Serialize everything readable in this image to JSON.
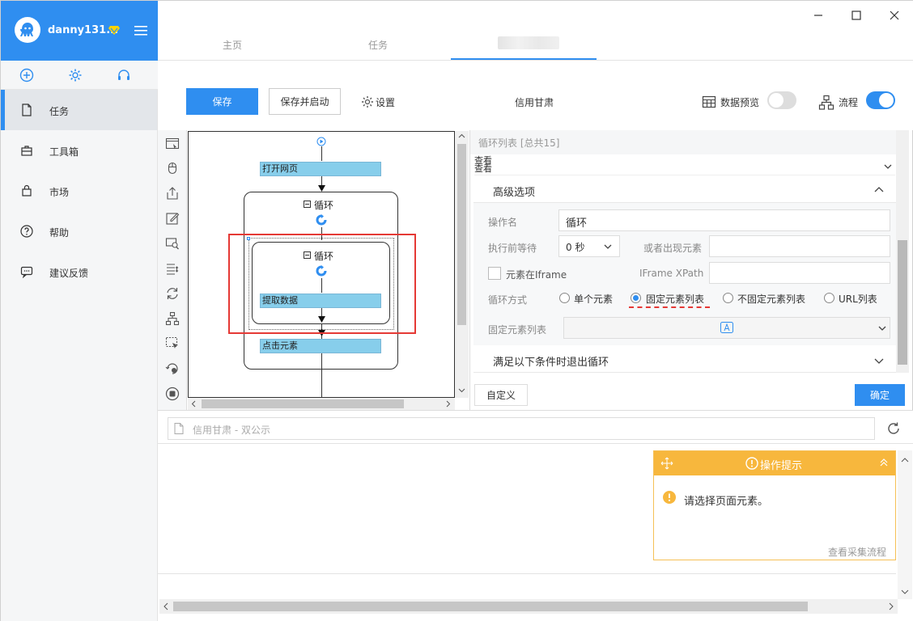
{
  "sidebar": {
    "username": "danny131...",
    "items": [
      {
        "label": "任务"
      },
      {
        "label": "工具箱"
      },
      {
        "label": "市场"
      },
      {
        "label": "帮助"
      },
      {
        "label": "建议反馈"
      }
    ]
  },
  "tabs": [
    {
      "label": "主页"
    },
    {
      "label": "任务"
    }
  ],
  "toolbar": {
    "save": "保存",
    "save_start": "保存并启动",
    "settings": "设置",
    "task_name": "信用甘肃",
    "preview": "数据预览",
    "flow": "流程",
    "preview_on": false,
    "flow_on": true
  },
  "canvas": {
    "open_page": "打开网页",
    "loop1": "循环",
    "loop2": "循环",
    "extract": "提取数据",
    "click": "点击元素"
  },
  "panel": {
    "header": "循环列表 [总共15]",
    "list_line1": "查看",
    "list_line2": "查看",
    "advanced": "高级选项",
    "op_name_label": "操作名",
    "op_name_value": "循环",
    "wait_label": "执行前等待",
    "wait_value": "0 秒",
    "or_appear_label": "或者出现元素",
    "iframe_label": "元素在Iframe",
    "iframe_xpath_label": "IFrame XPath",
    "loop_mode_label": "循环方式",
    "modes": [
      "单个元素",
      "固定元素列表",
      "不固定元素列表",
      "URL列表"
    ],
    "selected_mode": 1,
    "fixed_list_label": "固定元素列表",
    "exit_condition": "满足以下条件时退出循环",
    "custom": "自定义",
    "ok": "确定"
  },
  "browser": {
    "address": "信用甘肃 - 双公示",
    "hint_title": "操作提示",
    "hint_text": "请选择页面元素。",
    "hint_link": "查看采集流程"
  },
  "colors": {
    "accent": "#2f8ef0",
    "flow_node": "#87ceeb",
    "hint": "#f7b73d",
    "highlight": "#e53935"
  }
}
